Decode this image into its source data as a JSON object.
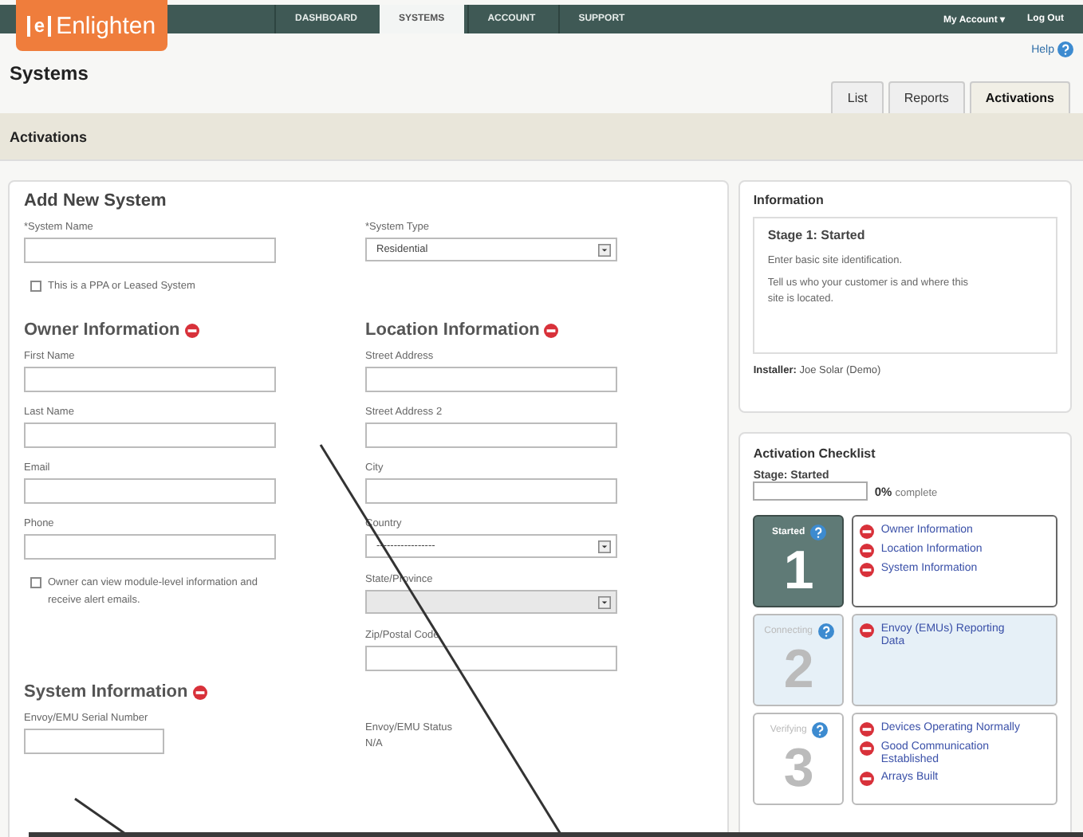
{
  "logo": {
    "mark": "e",
    "text": "Enlighten"
  },
  "nav": [
    {
      "label": "DASHBOARD",
      "selected": false
    },
    {
      "label": "SYSTEMS",
      "selected": true
    },
    {
      "label": "ACCOUNT",
      "selected": false
    },
    {
      "label": "SUPPORT",
      "selected": false
    }
  ],
  "account_menu": {
    "label": "My Account",
    "caret": "▾"
  },
  "logout": "Log Out",
  "help": "Help",
  "page_title": "Systems",
  "tabs": [
    {
      "label": "List",
      "selected": false
    },
    {
      "label": "Reports",
      "selected": false
    },
    {
      "label": "Activations",
      "selected": true
    }
  ],
  "section_title": "Activations",
  "form": {
    "title": "Add New System",
    "system_name_label": "*System Name",
    "system_type_label": "*System Type",
    "system_type_value": "Residential",
    "ppa": {
      "label": "This is a PPA or Leased System",
      "checked": false
    },
    "owner": {
      "title": "Owner Information",
      "complete": false,
      "fields": [
        "First Name",
        "Last Name",
        "Email",
        "Phone"
      ],
      "alerts": {
        "label": "Owner can view module-level information and receive alert emails.",
        "checked": false
      }
    },
    "location": {
      "title": "Location Information",
      "complete": false,
      "fields": [
        {
          "label": "Street Address",
          "kind": "text"
        },
        {
          "label": "Street Address 2",
          "kind": "text"
        },
        {
          "label": "City",
          "kind": "text"
        },
        {
          "label": "Country",
          "kind": "select",
          "value": "-----------------",
          "disabled": false
        },
        {
          "label": "State/Province",
          "kind": "select",
          "disabled": true
        },
        {
          "label": "Zip/Postal Code",
          "kind": "text"
        }
      ]
    },
    "system": {
      "title": "System Information",
      "complete": false,
      "serial_label": "Envoy/EMU Serial Number",
      "status_label": "Envoy/EMU Status",
      "status_value": "N/A"
    }
  },
  "information": {
    "title": "Information",
    "stage_title": "Stage 1: Started",
    "lines": [
      "Enter basic site identification.",
      "Tell us who your customer is and where this site is located."
    ],
    "installer_label": "Installer:",
    "installer": "Joe Solar (Demo)"
  },
  "checklist": {
    "title": "Activation Checklist",
    "stage_label": "Stage: Started",
    "level": 0,
    "percent": "0%",
    "complete_label": "complete",
    "stages": [
      {
        "name": "Started",
        "number": "1",
        "selected": true,
        "highlighted": false,
        "items": [
          {
            "label": "Owner Information",
            "complete": false
          },
          {
            "label": "Location Information",
            "complete": false
          },
          {
            "label": "System Information",
            "complete": false
          }
        ]
      },
      {
        "name": "Connecting",
        "number": "2",
        "selected": false,
        "highlighted": true,
        "items": [
          {
            "label": "Envoy (EMUs) Reporting Data",
            "complete": false
          }
        ]
      },
      {
        "name": "Verifying",
        "number": "3",
        "selected": false,
        "highlighted": false,
        "items": [
          {
            "label": "Devices Operating Normally",
            "complete": false
          },
          {
            "label": "Good Communication Established",
            "complete": false
          },
          {
            "label": "Arrays Built",
            "complete": false
          }
        ]
      }
    ]
  }
}
